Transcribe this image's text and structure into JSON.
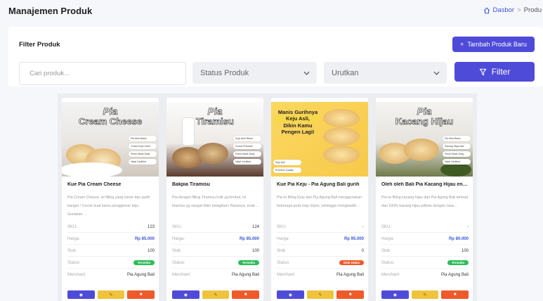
{
  "header": {
    "title": "Manajemen Produk",
    "breadcrumb_home": "Dasbor",
    "breadcrumb_sep": ">",
    "breadcrumb_current": "Produ"
  },
  "filter": {
    "title": "Filter Produk",
    "add_label": "Tambah Produk Baru",
    "search_placeholder": "Cari produk...",
    "status_label": "Status Produk",
    "sort_label": "Urutkan",
    "filter_label": "Filter"
  },
  "labels": {
    "sku": "SKU:",
    "price": "Harga:",
    "stock": "Stok:",
    "status": "Status:",
    "merchant": "Merchant:"
  },
  "colors": {
    "primary": "#4f4bd9",
    "available": "#2ebd5a",
    "soldout": "#ef5a2a",
    "edit": "#f0c33c"
  },
  "products": [
    {
      "banner_top": "Pia",
      "banner_bottom": "Cream Cheese",
      "name": "Kue Pia Cream Cheese",
      "desc": "Pia Cream Cheese, isi filling yang lumer dan gurih banget ! Cocok buat kamu penggemar keju Gunakan ...",
      "sku": "123",
      "price": "Rp 85.000",
      "stock": "100",
      "status": "Tersedia",
      "status_color": "#2ebd5a",
      "merchant": "Pia Agung Bali",
      "features": [
        "Pia Mini Manis",
        "Cream Keju Gurih",
        "Fresh Made Daily",
        "Halal Certified"
      ]
    },
    {
      "banner_top": "Pia",
      "banner_bottom": "Tiramisu",
      "name": "Bakpia Tiramisu",
      "desc": "Pia dengan filling Tiramisu kulit yg lembut, isi tiramisu yg sangat bikin ketagihan! Rasanya, enak ...",
      "sku": "124",
      "price": "Rp 85.000",
      "stock": "100",
      "status": "Tersedia",
      "status_color": "#2ebd5a",
      "merchant": "Pia Agung Bali",
      "features": [
        "Kopi Asli Pilihan",
        "Cocoa Premium",
        "Fresh Made Daily",
        "Halal Certified"
      ]
    },
    {
      "banner_top": "Manis Gurihnya",
      "banner_mid": "Keju Asli,",
      "banner_bottom": "Dikin Kamu Pengen Lagi!",
      "name": "Kue Pia Keju - Pia Agung Bali gurih",
      "desc": "Pia isi filling Keju dari Pia Agung Bali menggunakan beberapa jenis keju impor, sehingga menghasilk...",
      "sku": "-",
      "price": "Rp 95.000",
      "stock": "0",
      "status": "Stok Habis",
      "status_color": "#ef5a2a",
      "merchant": "Pia Agung Bali",
      "features": [
        "Keju Asli",
        "Premium Quality",
        "Fresh Made Daily",
        "Halal Certified"
      ]
    },
    {
      "banner_top": "Pia",
      "banner_bottom": "Kacang Hijau",
      "name": "Oleh oleh Bali Pia Kacang Hijau ena...",
      "desc": "Pia isi filling kacang hijau dari Pia Agung Bali terbuat dari 100% kacang hijau pilihan dengan rasa...",
      "sku": "-",
      "price": "Rp 80.000",
      "stock": "100",
      "status": "Tersedia",
      "status_color": "#2ebd5a",
      "merchant": "Pia Agung Bali",
      "features": [
        "Pia Mini Manis",
        "Kacang Hijau Asli",
        "Fresh Made Daily",
        "Halal Certified"
      ]
    }
  ]
}
